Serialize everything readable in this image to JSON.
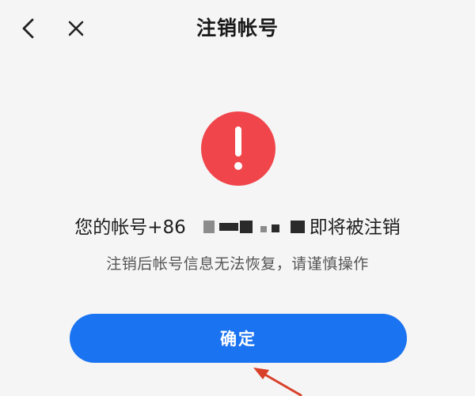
{
  "header": {
    "title": "注销帐号",
    "back_icon": "chevron-left-icon",
    "close_icon": "close-icon"
  },
  "warning": {
    "icon": "exclamation-icon",
    "color": "#f0454b",
    "message_prefix": "您的帐号+86",
    "message_suffix": "即将被注销",
    "subtext": "注销后帐号信息无法恢复，请谨慎操作"
  },
  "actions": {
    "confirm_label": "确定",
    "confirm_color": "#1a73f0"
  },
  "annotation": {
    "icon": "arrow-pointer-icon",
    "color": "#d8402a"
  }
}
